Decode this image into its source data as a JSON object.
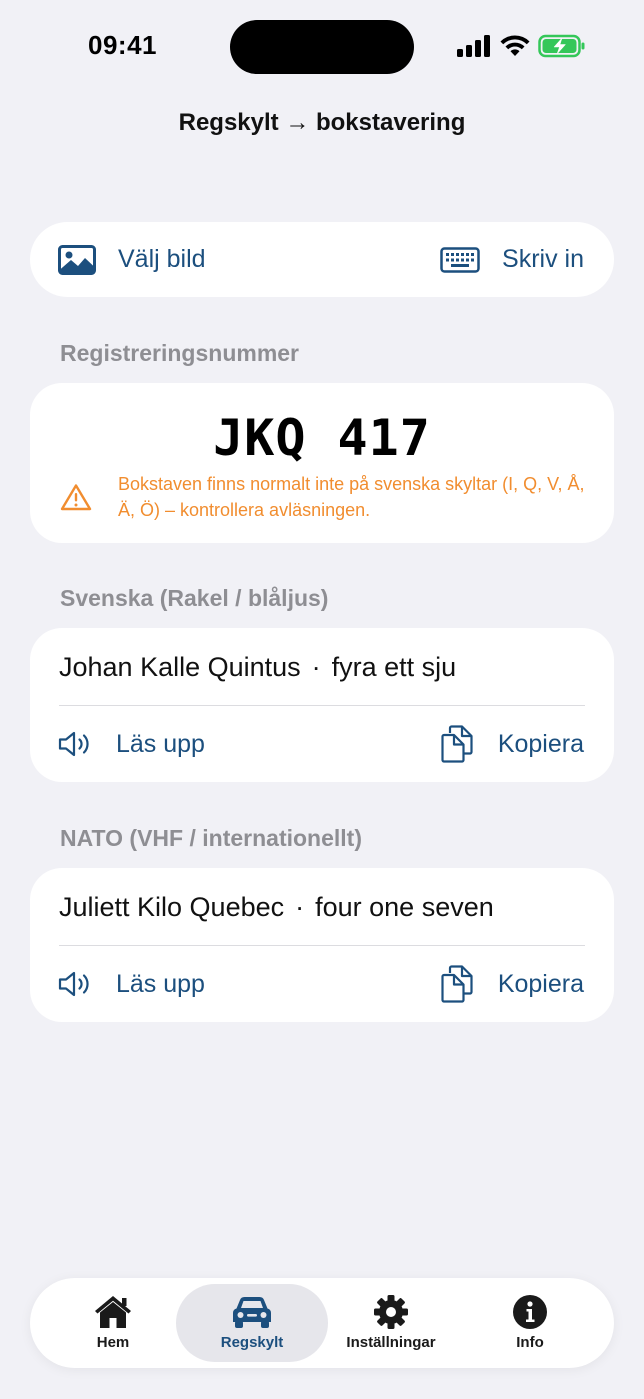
{
  "status_bar": {
    "time": "09:41"
  },
  "nav": {
    "title": "Regskylt → bokstavering"
  },
  "actions": {
    "pick_image": {
      "label": "Välj bild",
      "icon": "photo-icon"
    },
    "type_in": {
      "label": "Skriv in",
      "icon": "keyboard-icon"
    }
  },
  "plate": {
    "section_label": "Registreringsnummer",
    "number": "JKQ 417",
    "warning_icon": "warning-triangle-icon",
    "warning": "Bokstaven finns normalt inte på svenska skyltar (I, Q, V, Å, Ä, Ö) – kontrollera avläsningen."
  },
  "swedish": {
    "section_label": "Svenska (Rakel / blåljus)",
    "letters": "Johan Kalle Quintus",
    "separator": "·",
    "digits": "fyra ett sju",
    "speak_label": "Läs upp",
    "copy_label": "Kopiera"
  },
  "nato": {
    "section_label": "NATO (VHF / internationellt)",
    "letters": "Juliett Kilo Quebec",
    "separator": "·",
    "digits": "four one seven",
    "speak_label": "Läs upp",
    "copy_label": "Kopiera"
  },
  "tabs": [
    {
      "label": "Hem",
      "icon": "house-icon",
      "active": false
    },
    {
      "label": "Regskylt",
      "icon": "car-icon",
      "active": true
    },
    {
      "label": "Inställningar",
      "icon": "gear-icon",
      "active": false
    },
    {
      "label": "Info",
      "icon": "info-icon",
      "active": false
    }
  ],
  "colors": {
    "accent": "#1c4f7e",
    "warning": "#f18d2f",
    "background": "#f1f1f6",
    "section_label": "#8e8e93"
  }
}
